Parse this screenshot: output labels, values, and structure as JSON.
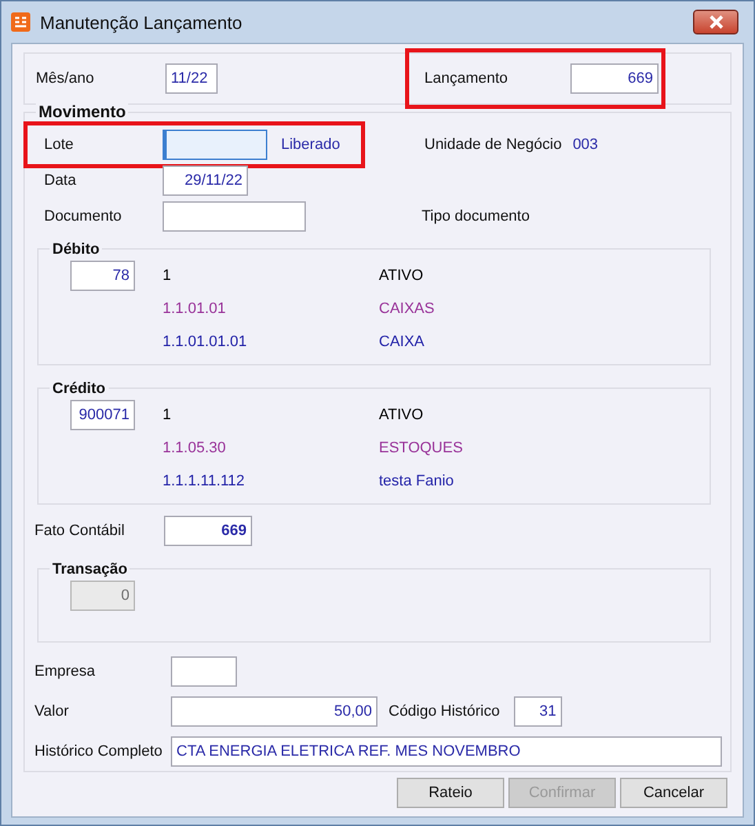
{
  "window": {
    "title": "Manutenção Lançamento"
  },
  "header": {
    "period": {
      "label": "Mês/ano",
      "value": "11/22"
    },
    "entry": {
      "label": "Lançamento",
      "value": "669",
      "highlighted": true
    }
  },
  "movement": {
    "title": "Movimento",
    "batch": {
      "label": "Lote",
      "focused": true,
      "status": "Liberado",
      "highlighted": true
    },
    "business_unit": {
      "label": "Unidade de Negócio",
      "value": "003"
    },
    "date": {
      "label": "Data",
      "value": "29/11/22"
    },
    "document": {
      "label": "Documento"
    },
    "document_type": {
      "label": "Tipo documento"
    },
    "accounts": [
      {
        "title": "Débito",
        "code": "78",
        "lines": [
          {
            "code": "1",
            "name": "ATIVO",
            "color": "#000000"
          },
          {
            "code": "1.1.01.01",
            "name": "CAIXAS",
            "color": "#993399"
          },
          {
            "code": "1.1.01.01.01",
            "name": "CAIXA",
            "color": "#2323a8"
          }
        ]
      },
      {
        "title": "Crédito",
        "code": "900071",
        "lines": [
          {
            "code": "1",
            "name": "ATIVO",
            "color": "#000000"
          },
          {
            "code": "1.1.05.30",
            "name": "ESTOQUES",
            "color": "#993399"
          },
          {
            "code": "1.1.1.11.112",
            "name": "testa Fanio",
            "color": "#2323a8"
          }
        ]
      }
    ],
    "accounting_fact": {
      "label": "Fato Contábil",
      "value": "669"
    },
    "transaction": {
      "title": "Transação",
      "value": "0",
      "disabled": true
    },
    "company": {
      "label": "Empresa"
    },
    "amount": {
      "label": "Valor",
      "value": "50,00"
    },
    "history_code": {
      "label": "Código Histórico",
      "value": "31"
    },
    "full_history": {
      "label": "Histórico Completo",
      "value": "CTA ENERGIA ELETRICA REF. MES NOVEMBRO"
    }
  },
  "buttons": [
    {
      "label": "Rateio",
      "disabled": false
    },
    {
      "label": "Confirmar",
      "disabled": true
    },
    {
      "label": "Cancelar",
      "disabled": false
    }
  ]
}
